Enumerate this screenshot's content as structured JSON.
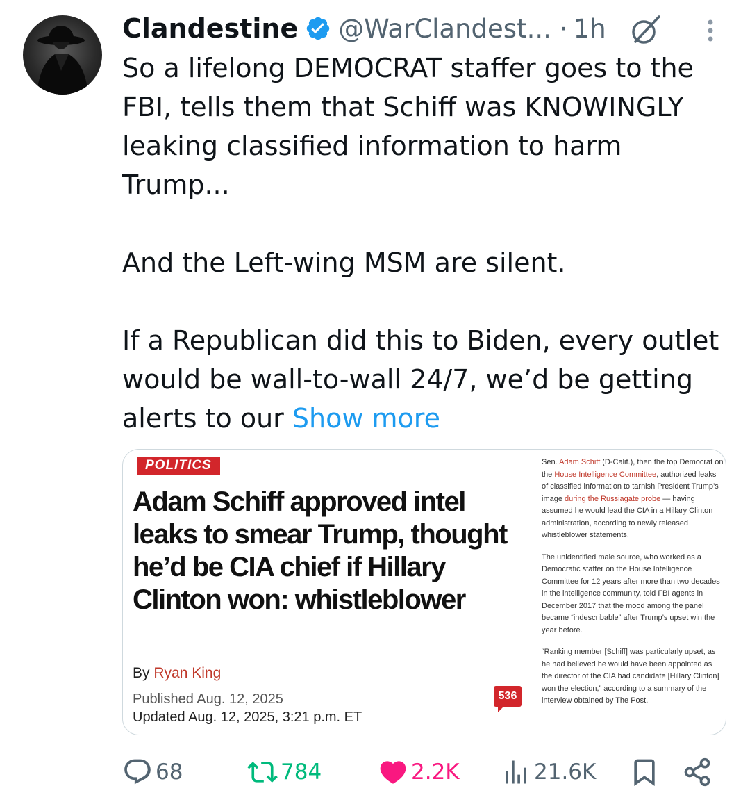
{
  "tweet": {
    "author_name": "Clandestine",
    "handle": "@WarClandest...",
    "separator": "·",
    "time": "1h",
    "text_paragraphs": [
      "So a lifelong DEMOCRAT staffer goes to the FBI, tells them that Schiff was KNOWINGLY leaking classified information to harm Trump...",
      "And the Left-wing MSM are silent.",
      "If a Republican did this to Biden, every outlet would be wall-to-wall 24/7, we’d be getting alerts to our"
    ],
    "show_more": "Show more"
  },
  "card": {
    "section": "POLITICS",
    "headline": "Adam Schiff approved intel leaks to smear Trump, thought he’d be CIA chief if Hillary Clinton won: whistleblower",
    "by_label": "By",
    "author": "Ryan King",
    "published": "Published Aug. 12, 2025",
    "updated": "Updated Aug. 12, 2025, 3:21 p.m. ET",
    "comment_count": "536",
    "para1_a": "Sen. ",
    "para1_link1": "Adam Schiff",
    "para1_b": " (D-Calif.), then the top Democrat on the ",
    "para1_link2": "House Intelligence Committee",
    "para1_c": ", authorized leaks of classified information to tarnish President Trump’s image ",
    "para1_link3": "during the Russiagate probe",
    "para1_d": " — having assumed he would lead the CIA in a Hillary Clinton administration, according to newly released whistleblower statements.",
    "para2": "The unidentified male source, who worked as a Democratic staffer on the House Intelligence Committee for 12 years after more than two decades in the intelligence community, told FBI agents in December 2017 that the mood among the panel became “indescribable” after Trump’s upset win the year before.",
    "para3": "“Ranking member [Schiff] was particularly upset, as he had believed he would have been appointed as the director of the CIA had candidate [Hillary Clinton] won the election,” according to a summary of the interview obtained by The Post."
  },
  "actions": {
    "replies": "68",
    "reposts": "784",
    "likes": "2.2K",
    "views": "21.6K"
  },
  "colors": {
    "accent": "#1d9bf0",
    "repost": "#00ba7c",
    "like": "#f91880",
    "muted": "#536471",
    "post_red": "#d2262b"
  },
  "icons": [
    "verified-badge-icon",
    "grok-icon",
    "more-icon",
    "reply-icon",
    "repost-icon",
    "like-icon",
    "views-icon",
    "bookmark-icon",
    "share-icon"
  ]
}
